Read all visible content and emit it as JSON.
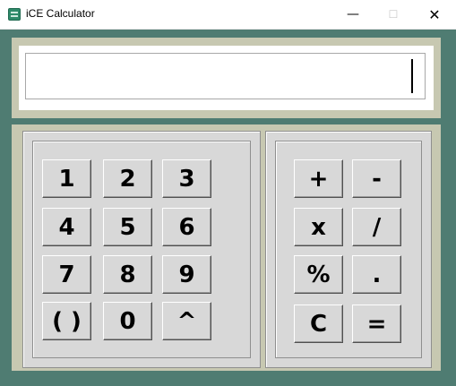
{
  "window": {
    "title": "iCE Calculator",
    "controls": {
      "minimize": "—",
      "maximize": "☐",
      "close": "✕"
    }
  },
  "display": {
    "value": ""
  },
  "keypad": {
    "digits": [
      [
        "1",
        "2",
        "3"
      ],
      [
        "4",
        "5",
        "6"
      ],
      [
        "7",
        "8",
        "9"
      ],
      [
        "( )",
        "0",
        "^"
      ]
    ],
    "operators": [
      [
        "+",
        "-"
      ],
      [
        "x",
        "/"
      ],
      [
        "%",
        "."
      ],
      [
        "C",
        "="
      ]
    ]
  },
  "colors": {
    "window_bg": "#4f7c72",
    "panel_bg": "#c7c8b1",
    "button_face": "#d8d8d8",
    "display_bg": "#ffffff"
  },
  "icons": {
    "app": "calculator-icon"
  }
}
